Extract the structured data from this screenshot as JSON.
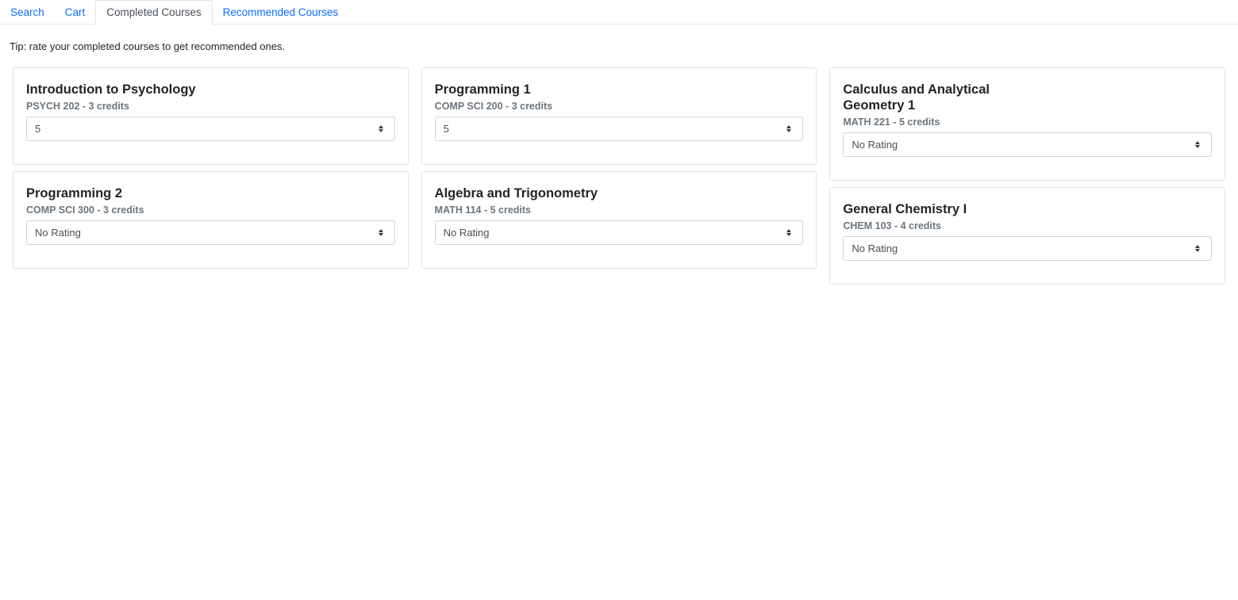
{
  "tabs": [
    {
      "label": "Search",
      "active": false
    },
    {
      "label": "Cart",
      "active": false
    },
    {
      "label": "Completed Courses",
      "active": true
    },
    {
      "label": "Recommended Courses",
      "active": false
    }
  ],
  "tip": "Tip: rate your completed courses to get recommended ones.",
  "courses": [
    {
      "name": "Introduction to Psychology",
      "meta": "PSYCH 202 - 3 credits",
      "rating": "5"
    },
    {
      "name": "Programming 2",
      "meta": "COMP SCI 300 - 3 credits",
      "rating": "No Rating"
    },
    {
      "name": "Programming 1",
      "meta": "COMP SCI 200 - 3 credits",
      "rating": "5"
    },
    {
      "name": "Algebra and Trigonometry",
      "meta": "MATH 114 - 5 credits",
      "rating": "No Rating"
    },
    {
      "name": "Calculus and Analytical Geometry 1",
      "meta": "MATH 221 - 5 credits",
      "rating": "No Rating"
    },
    {
      "name": "General Chemistry I",
      "meta": "CHEM 103 - 4 credits",
      "rating": "No Rating"
    }
  ],
  "colors": {
    "link": "#0d6efd",
    "subtitle": "#6c757d",
    "border": "#dee2e6"
  },
  "icons": {
    "select_arrow": "up-down-caret-icon"
  }
}
